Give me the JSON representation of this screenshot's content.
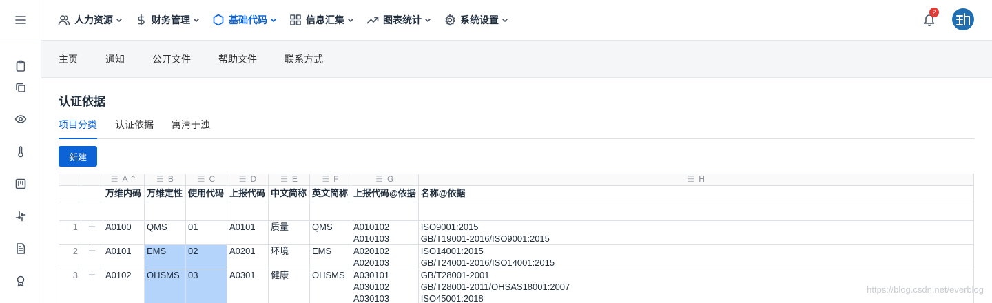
{
  "topnav": {
    "items": [
      {
        "label": "人力资源",
        "icon": "users-icon"
      },
      {
        "label": "财务管理",
        "icon": "dollar-icon"
      },
      {
        "label": "基础代码",
        "icon": "hexagon-icon",
        "active": true
      },
      {
        "label": "信息汇集",
        "icon": "grid-icon"
      },
      {
        "label": "图表统计",
        "icon": "trend-icon"
      },
      {
        "label": "系统设置",
        "icon": "gear-icon"
      }
    ],
    "notification_count": "2",
    "accent": "#0b63d6"
  },
  "subnav": [
    "主页",
    "通知",
    "公开文件",
    "帮助文件",
    "联系方式"
  ],
  "page": {
    "title": "认证依据",
    "tabs": [
      "项目分类",
      "认证依据",
      "寓清于浊"
    ],
    "new_button": "新建"
  },
  "grid": {
    "column_letters": [
      "A",
      "B",
      "C",
      "D",
      "E",
      "F",
      "G",
      "H"
    ],
    "headers": [
      "万维内码",
      "万维定性",
      "使用代码",
      "上报代码",
      "中文简称",
      "英文简称",
      "上报代码@依据",
      "名称@依据"
    ],
    "rows": [
      {
        "num": "1",
        "a": "A0100",
        "b": "QMS",
        "c": "01",
        "d": "A0101",
        "e": "质量",
        "f": "QMS",
        "g": [
          "A010102",
          "A010103"
        ],
        "h": [
          "ISO9001:2015",
          "GB/T19001-2016/ISO9001:2015"
        ]
      },
      {
        "num": "2",
        "a": "A0101",
        "b": "EMS",
        "c": "02",
        "d": "A0201",
        "e": "环境",
        "f": "EMS",
        "g": [
          "A020102",
          "A020103"
        ],
        "h": [
          "ISO14001:2015",
          "GB/T24001-2016/ISO14001:2015"
        ]
      },
      {
        "num": "3",
        "a": "A0102",
        "b": "OHSMS",
        "c": "03",
        "d": "A0301",
        "e": "健康",
        "f": "OHSMS",
        "g": [
          "A030101",
          "A030102",
          "A030103"
        ],
        "h": [
          "GB/T28001-2001",
          "GB/T28001-2011/OHSAS18001:2007",
          "ISO45001:2018"
        ]
      }
    ]
  },
  "watermark": "https://blog.csdn.net/everblog"
}
